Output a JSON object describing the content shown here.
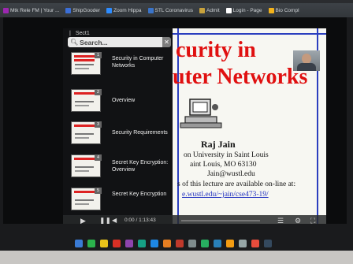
{
  "browser": {
    "bookmarks": [
      {
        "label": "Mtk Rele FM | Your ...",
        "color": "#9c27b0"
      },
      {
        "label": "ShipGooder",
        "color": "#3b6fd8"
      },
      {
        "label": "Zoom Hippa",
        "color": "#2d8cff"
      },
      {
        "label": "STL Coronavirus",
        "color": "#3a74c9"
      },
      {
        "label": "Admit",
        "color": "#c8a23c"
      },
      {
        "label": "Login - Page",
        "color": "#ffffff"
      },
      {
        "label": "Bio Compl",
        "color": "#f2b21b"
      }
    ]
  },
  "sidebar": {
    "header": "Sect1",
    "search_placeholder": "Search...",
    "items": [
      {
        "number": "1",
        "label": "Security in Computer Networks"
      },
      {
        "number": "2",
        "label": "Overview"
      },
      {
        "number": "3",
        "label": "Security Requirements"
      },
      {
        "number": "4",
        "label": "Secret Key Encryption: Overview"
      },
      {
        "number": "5",
        "label": "Secret Key Encryption"
      }
    ]
  },
  "slide": {
    "title_line1": "curity in",
    "title_line2": "uter Networks",
    "author": "Raj Jain",
    "line1": "on University in Saint Louis",
    "line2": "aint Louis, MO 63130",
    "line3": "Jain@wustl.edu",
    "line4": "s of this lecture are available on-line at:",
    "link": "e.wustl.edu/~jain/cse473-19/"
  },
  "player": {
    "time": "0:00 / 1:13:43"
  },
  "colors": {
    "slide_title": "#e01010",
    "slide_border": "#2b3fbf",
    "sidebar_bg": "#121315"
  },
  "icons": [
    "play-icon",
    "pause-icon",
    "volume-icon",
    "captions-icon",
    "settings-icon",
    "fullscreen-icon",
    "close-icon",
    "search-icon"
  ]
}
